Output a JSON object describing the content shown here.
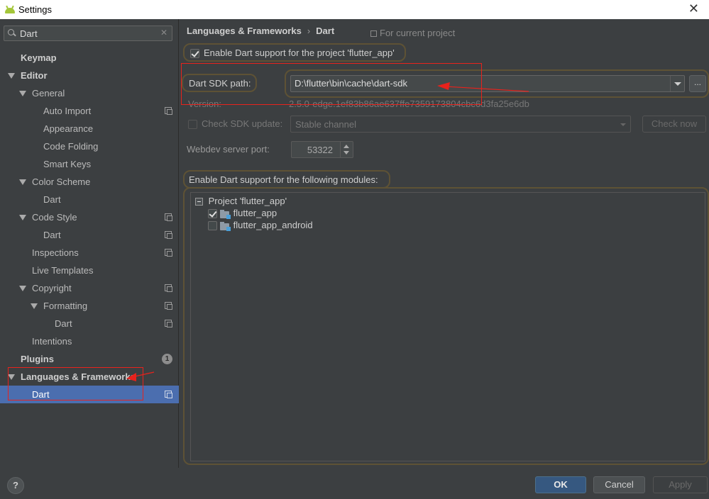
{
  "window": {
    "title": "Settings",
    "close_glyph": "✕"
  },
  "search": {
    "value": "Dart",
    "clear_glyph": "✕"
  },
  "tree": [
    {
      "label": "Keymap",
      "level": 0,
      "bold": true,
      "arrow": false,
      "project_icon": false
    },
    {
      "label": "Editor",
      "level": 0,
      "bold": true,
      "arrow": true,
      "project_icon": false
    },
    {
      "label": "General",
      "level": 1,
      "bold": false,
      "arrow": true,
      "project_icon": false
    },
    {
      "label": "Auto Import",
      "level": 2,
      "bold": false,
      "arrow": false,
      "project_icon": true
    },
    {
      "label": "Appearance",
      "level": 2,
      "bold": false,
      "arrow": false,
      "project_icon": false
    },
    {
      "label": "Code Folding",
      "level": 2,
      "bold": false,
      "arrow": false,
      "project_icon": false
    },
    {
      "label": "Smart Keys",
      "level": 2,
      "bold": false,
      "arrow": false,
      "project_icon": false
    },
    {
      "label": "Color Scheme",
      "level": 1,
      "bold": false,
      "arrow": true,
      "project_icon": false
    },
    {
      "label": "Dart",
      "level": 2,
      "bold": false,
      "arrow": false,
      "project_icon": false
    },
    {
      "label": "Code Style",
      "level": 1,
      "bold": false,
      "arrow": true,
      "project_icon": true
    },
    {
      "label": "Dart",
      "level": 2,
      "bold": false,
      "arrow": false,
      "project_icon": true
    },
    {
      "label": "Inspections",
      "level": 1,
      "bold": false,
      "arrow": false,
      "project_icon": true
    },
    {
      "label": "Live Templates",
      "level": 1,
      "bold": false,
      "arrow": false,
      "project_icon": false
    },
    {
      "label": "Copyright",
      "level": 1,
      "bold": false,
      "arrow": true,
      "project_icon": true
    },
    {
      "label": "Formatting",
      "level": 2,
      "bold": false,
      "arrow": true,
      "project_icon": true
    },
    {
      "label": "Dart",
      "level": 3,
      "bold": false,
      "arrow": false,
      "project_icon": true
    },
    {
      "label": "Intentions",
      "level": 1,
      "bold": false,
      "arrow": false,
      "project_icon": false
    },
    {
      "label": "Plugins",
      "level": 0,
      "bold": true,
      "arrow": false,
      "project_icon": false,
      "badge": "1"
    },
    {
      "label": "Languages & Frameworks",
      "level": 0,
      "bold": true,
      "arrow": true,
      "project_icon": false
    },
    {
      "label": "Dart",
      "level": 1,
      "bold": false,
      "arrow": false,
      "project_icon": true,
      "selected": true
    }
  ],
  "help_label": "?",
  "breadcrumb": {
    "parent": "Languages & Frameworks",
    "separator": "›",
    "current": "Dart"
  },
  "for_current_project": "For current project",
  "enable_dart": {
    "label": "Enable Dart support for the project 'flutter_app'",
    "checked": true
  },
  "sdk": {
    "label": "Dart SDK path:",
    "value": "D:\\flutter\\bin\\cache\\dart-sdk",
    "browse_label": "..."
  },
  "version": {
    "label": "Version:",
    "value": "2.5.0-edge.1ef83b86ae637ffe7359173804cbc6d3fa25e6db"
  },
  "check_sdk_update": {
    "label": "Check SDK update:",
    "checked": false,
    "channel": "Stable channel",
    "check_now_label": "Check now"
  },
  "webdev": {
    "label": "Webdev server port:",
    "port": "53322"
  },
  "modules": {
    "label": "Enable Dart support for the following modules:",
    "project_label": "Project 'flutter_app'",
    "items": [
      {
        "name": "flutter_app",
        "checked": true
      },
      {
        "name": "flutter_app_android",
        "checked": false
      }
    ]
  },
  "buttons": {
    "ok": "OK",
    "cancel": "Cancel",
    "apply": "Apply"
  },
  "colors": {
    "annotation_red": "#e8221c",
    "selection_blue": "#4b6eaf",
    "highlight_outline": "#5e5235"
  }
}
